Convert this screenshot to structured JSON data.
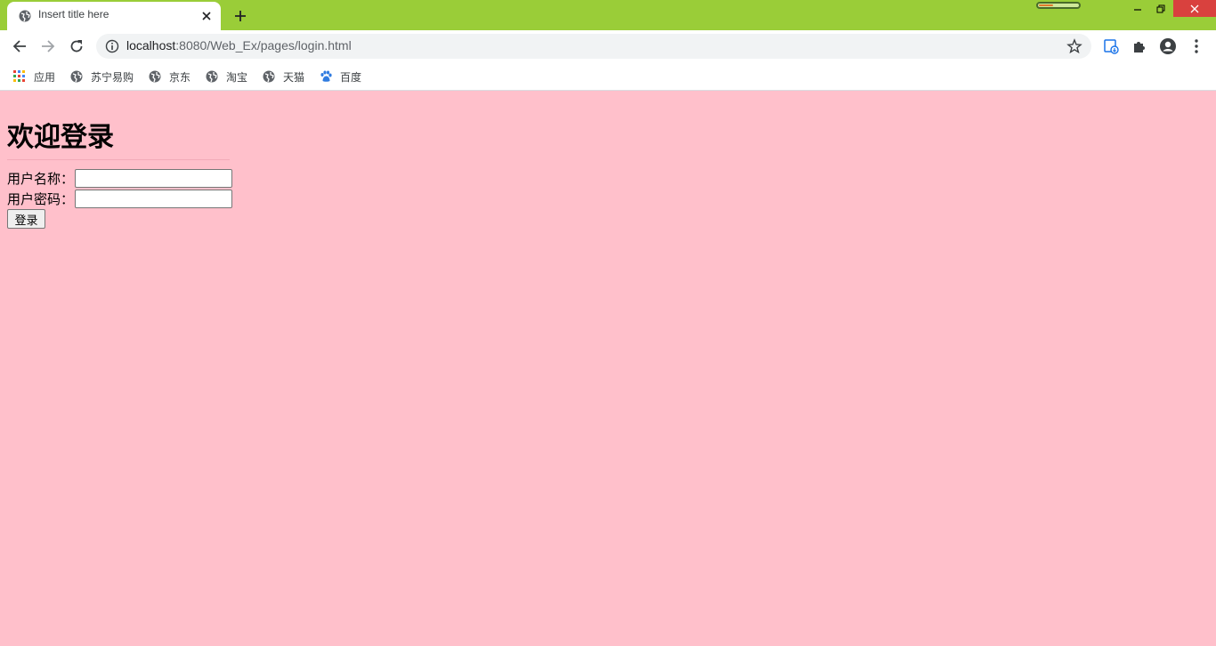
{
  "browser": {
    "tab": {
      "title": "Insert title here"
    },
    "omnibox": {
      "url_host": "localhost",
      "url_rest": ":8080/Web_Ex/pages/login.html"
    },
    "bookmarks": [
      {
        "label": "应用",
        "icon": "apps-grid-icon"
      },
      {
        "label": "苏宁易购",
        "icon": "globe-icon"
      },
      {
        "label": "京东",
        "icon": "globe-icon"
      },
      {
        "label": "淘宝",
        "icon": "globe-icon"
      },
      {
        "label": "天猫",
        "icon": "globe-icon"
      },
      {
        "label": "百度",
        "icon": "paw-icon"
      }
    ],
    "colors": {
      "titlebar": "#9acd38",
      "close_button": "#d9413e"
    }
  },
  "page": {
    "heading": "欢迎登录",
    "username_label": "用户名称：",
    "password_label": "用户密码：",
    "login_button": "登录",
    "background": "#ffc0cb"
  }
}
